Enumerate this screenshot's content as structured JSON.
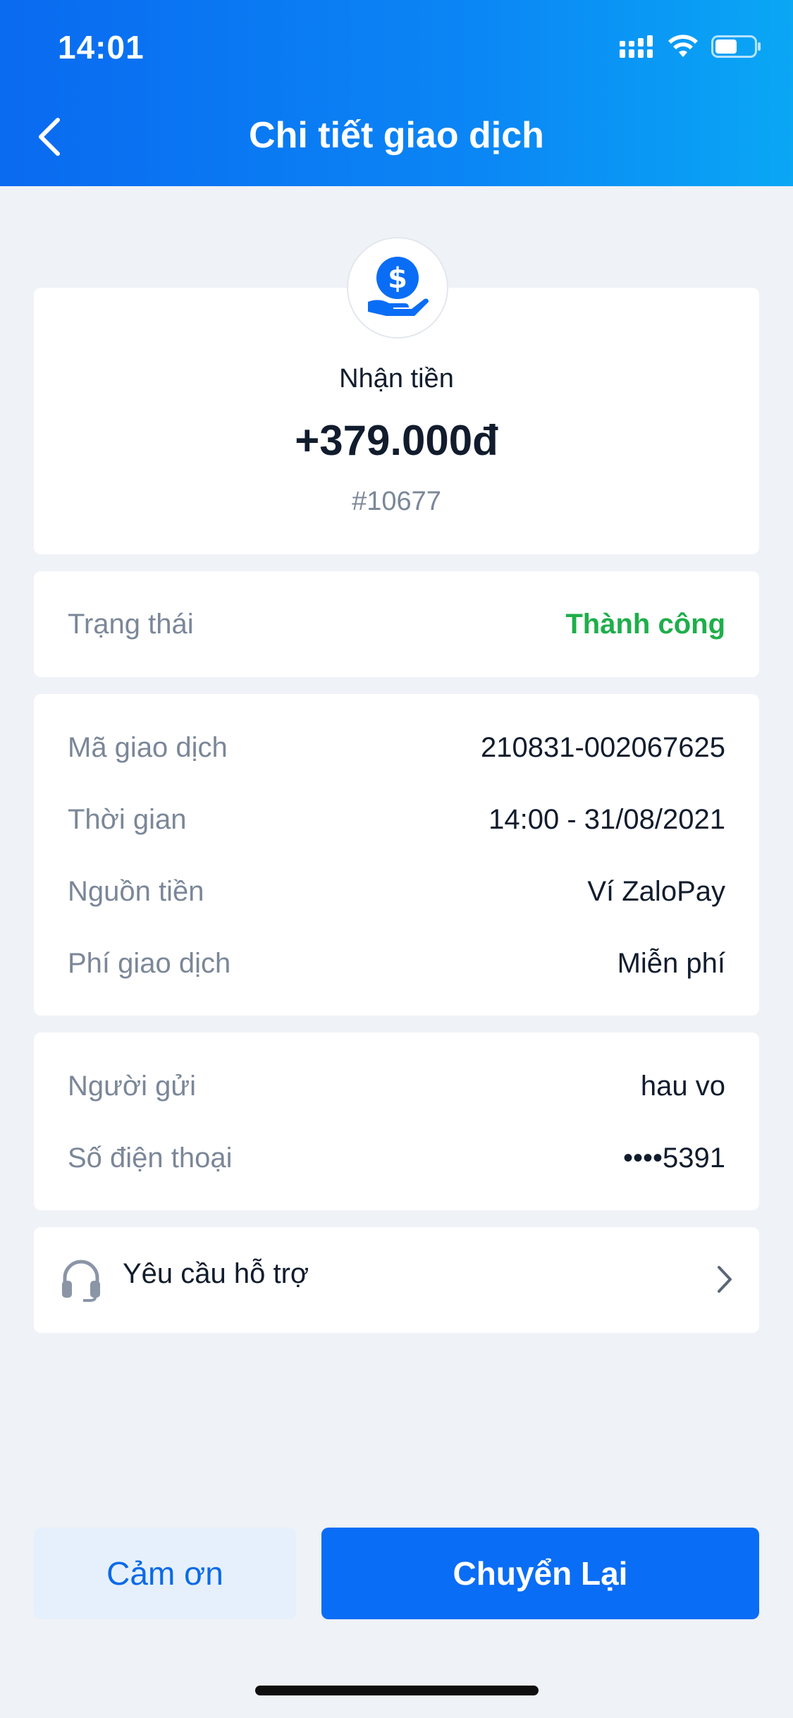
{
  "status_bar": {
    "time": "14:01"
  },
  "header": {
    "title": "Chi tiết giao dịch"
  },
  "summary": {
    "type_label": "Nhận tiền",
    "amount": "+379.000đ",
    "code": "#10677",
    "icon": "money-receive-icon"
  },
  "status": {
    "label": "Trạng thái",
    "value": "Thành công",
    "value_color": "#1fae4b"
  },
  "details": [
    {
      "label": "Mã giao dịch",
      "value": "210831-002067625"
    },
    {
      "label": "Thời gian",
      "value": "14:00 - 31/08/2021"
    },
    {
      "label": "Nguồn tiền",
      "value": "Ví ZaloPay"
    },
    {
      "label": "Phí giao dịch",
      "value": "Miễn phí"
    }
  ],
  "sender": [
    {
      "label": "Người gửi",
      "value": "hau vo"
    },
    {
      "label": "Số điện thoại",
      "value": "••••5391"
    }
  ],
  "support": {
    "label": "Yêu cầu hỗ trợ",
    "icon": "headset-icon"
  },
  "actions": {
    "thanks_label": "Cảm ơn",
    "resend_label": "Chuyển Lại"
  },
  "colors": {
    "accent": "#0a6df5",
    "success": "#1fae4b",
    "background": "#eff2f6"
  }
}
